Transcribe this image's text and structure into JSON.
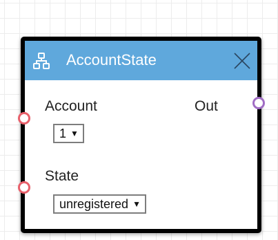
{
  "node": {
    "title": "AccountState",
    "header_color": "#5fa8dc",
    "header_icon": "hierarchy-icon",
    "close_icon": "close-icon",
    "inputs": [
      {
        "label": "Account",
        "value": "1",
        "port_color": "#e8606b"
      },
      {
        "label": "State",
        "value": "unregistered",
        "port_color": "#e8606b"
      }
    ],
    "outputs": [
      {
        "label": "Out",
        "port_color": "#a06cc4"
      }
    ],
    "dropdown_caret": "▼"
  }
}
